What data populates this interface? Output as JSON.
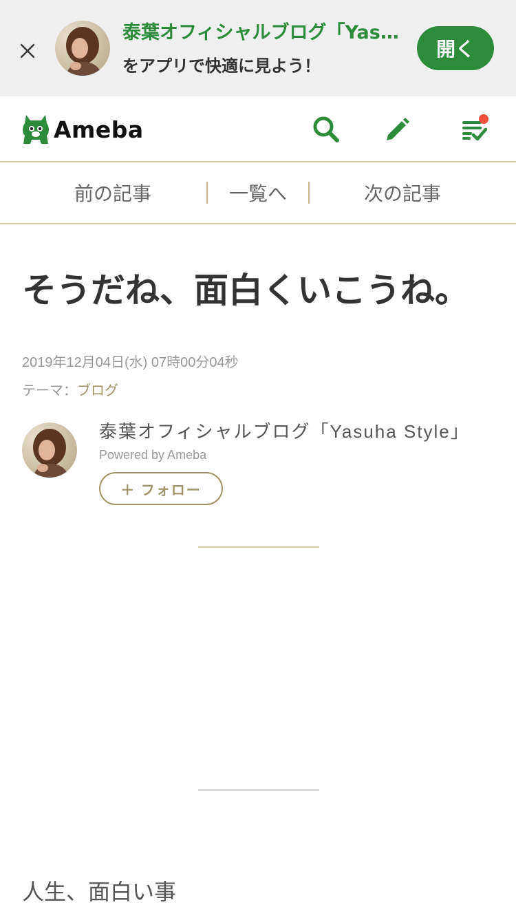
{
  "app_banner": {
    "title": "泰葉オフィシャルブログ「Yasuha Style」",
    "subtitle": "をアプリで快適に見よう！",
    "open_label": "開く"
  },
  "header": {
    "logo_text": "Ameba"
  },
  "article_nav": {
    "prev_label": "前の記事",
    "list_label": "一覧へ",
    "next_label": "次の記事"
  },
  "article": {
    "title": "そうだね、面白くいこうね。",
    "date": "2019年12月04日(水) 07時00分04秒",
    "theme_prefix": "テーマ：",
    "theme_link": "ブログ",
    "body_first_line": "人生、面白い事"
  },
  "author": {
    "blog_name": "泰葉オフィシャルブログ「Yasuha Style」",
    "powered_by": "Powered by Ameba",
    "follow_label": "＋ フォロー"
  },
  "colors": {
    "brand_green": "#2d8c3c",
    "accent_gold": "#a0946a",
    "notification_red": "#f0513c"
  }
}
